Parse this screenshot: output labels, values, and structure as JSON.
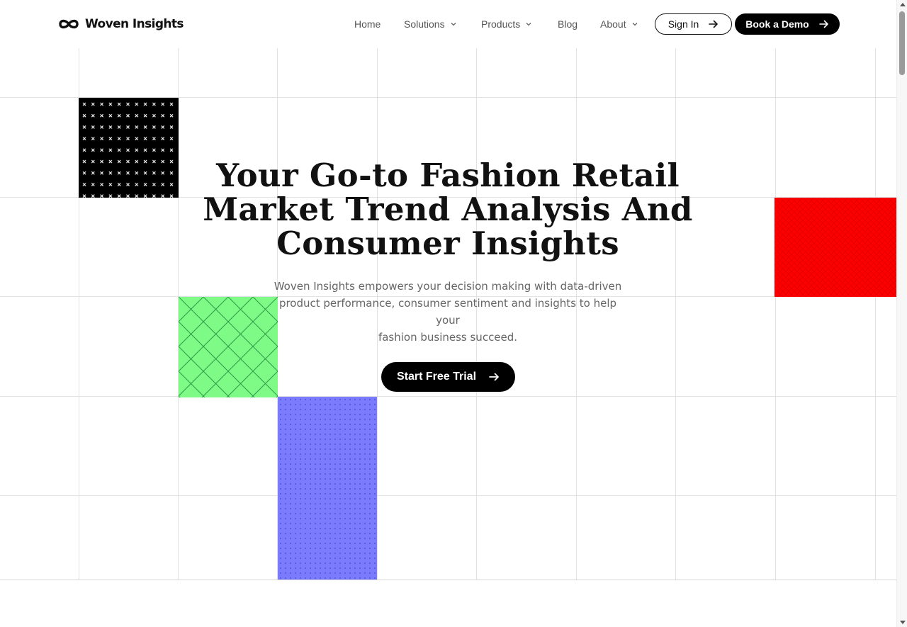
{
  "brand": {
    "name": "Woven Insights"
  },
  "nav": {
    "items": [
      {
        "label": "Home",
        "has_dropdown": false
      },
      {
        "label": "Solutions",
        "has_dropdown": true
      },
      {
        "label": "Products",
        "has_dropdown": true
      },
      {
        "label": "Blog",
        "has_dropdown": false
      },
      {
        "label": "About",
        "has_dropdown": true
      }
    ],
    "sign_in": "Sign In",
    "book_demo": "Book a Demo"
  },
  "hero": {
    "headline_lines": [
      "Your Go-to Fashion Retail",
      "Market Trend Analysis And",
      "Consumer Insights"
    ],
    "subline_lines": [
      "Woven Insights empowers your decision making with data-driven",
      "product performance, consumer sentiment and insights to help your",
      "fashion business succeed."
    ],
    "cta": "Start Free Trial"
  },
  "colors": {
    "tile_black": "#000000",
    "tile_red": "#ff0000",
    "tile_green": "#7dfb86",
    "tile_blue": "#7b7bfd",
    "button_dark": "#000000"
  },
  "icons": {
    "logo": "woven-infinity-icon",
    "arrow": "arrow-right-icon",
    "chevron": "chevron-down-icon"
  }
}
